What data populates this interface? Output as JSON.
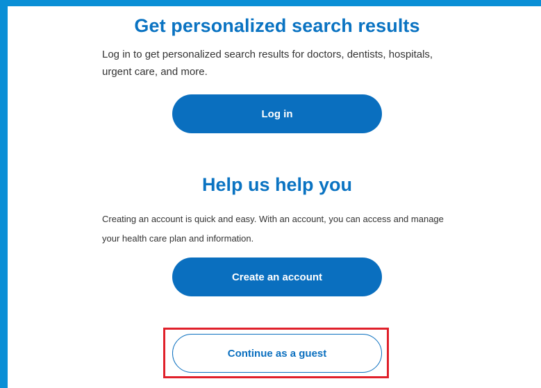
{
  "login_section": {
    "heading": "Get personalized search results",
    "body": "Log in to get personalized search results for doctors, dentists, hospitals, urgent care, and more.",
    "login_button": "Log in"
  },
  "signup_section": {
    "heading": "Help us help you",
    "body": "Creating an account is quick and easy. With an account, you can access and manage your health care plan and information.",
    "create_button": "Create an account"
  },
  "guest": {
    "continue_button": "Continue as a guest"
  },
  "colors": {
    "accent": "#0a73c2",
    "frame": "#0a8fd6",
    "highlight": "#e0202a"
  }
}
